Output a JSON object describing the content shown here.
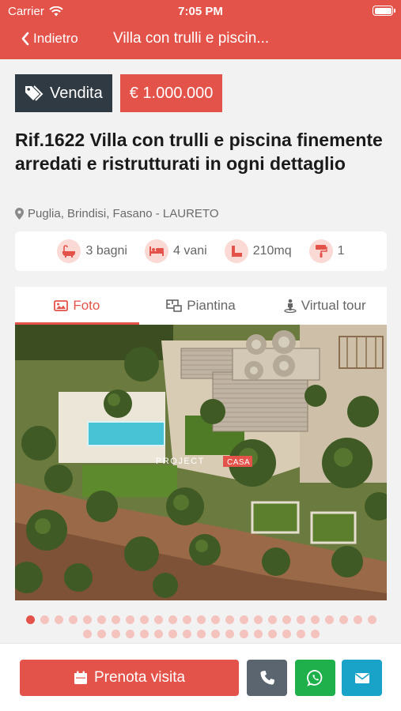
{
  "status_bar": {
    "carrier": "Carrier",
    "time": "7:05 PM"
  },
  "nav": {
    "back_label": "Indietro",
    "title": "Villa con trulli e piscin..."
  },
  "tags": {
    "contract": "Vendita",
    "price": "€ 1.000.000"
  },
  "listing": {
    "title": "Rif.1622 Villa con trulli e piscina finemente arredati e ristrutturati in ogni dettaglio",
    "location": "Puglia, Brindisi, Fasano - LAURETO"
  },
  "features": {
    "bathrooms": "3 bagni",
    "rooms": "4 vani",
    "area": "210mq",
    "renovation": "1"
  },
  "tabs": [
    {
      "label": "Foto",
      "active": true
    },
    {
      "label": "Piantina",
      "active": false
    },
    {
      "label": "Virtual tour",
      "active": false
    }
  ],
  "gallery": {
    "watermark_left": "PROJECT",
    "watermark_right": "CASA",
    "total_photos": 42,
    "current_index": 1
  },
  "actions": {
    "book_label": "Prenota visita"
  },
  "colors": {
    "accent": "#e4534a",
    "dark": "#2f3a42",
    "phone": "#5a6570",
    "whatsapp": "#20b04b",
    "email": "#1aa3c8"
  }
}
